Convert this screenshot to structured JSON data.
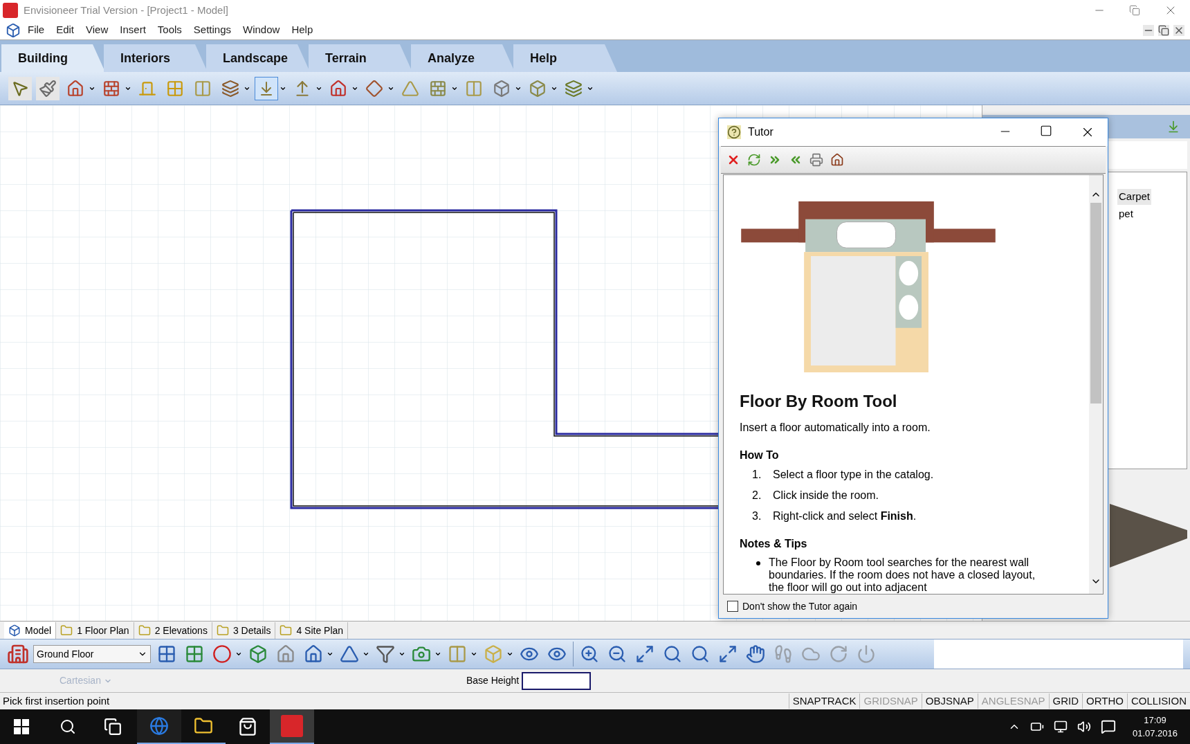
{
  "window": {
    "title": "Envisioneer Trial Version - [Project1 - Model]"
  },
  "menu": [
    "File",
    "Edit",
    "View",
    "Insert",
    "Tools",
    "Settings",
    "Window",
    "Help"
  ],
  "ribbon_tabs": [
    {
      "label": "Building",
      "selected": true
    },
    {
      "label": "Interiors",
      "selected": false
    },
    {
      "label": "Landscape",
      "selected": false
    },
    {
      "label": "Terrain",
      "selected": false
    },
    {
      "label": "Analyze",
      "selected": false
    },
    {
      "label": "Help",
      "selected": false
    }
  ],
  "catalog_panel": {
    "items": [
      {
        "label": "Carpet",
        "selected": true
      },
      {
        "label": "pet",
        "selected": false
      }
    ]
  },
  "tutor": {
    "title": "Tutor",
    "heading": "Floor By Room Tool",
    "intro": "Insert a floor automatically into a room.",
    "how_to_heading": "How To",
    "steps": [
      {
        "number": "1.",
        "text": "Select a floor type in the catalog."
      },
      {
        "number": "2.",
        "text": "Click inside the room."
      },
      {
        "number": "3.",
        "text": "Right-click and select **Finish**."
      }
    ],
    "notes_heading": "Notes & Tips",
    "notes": [
      "The Floor by Room tool searches for the nearest wall boundaries. If the room does not have a closed layout, the floor will go out into adjacent"
    ],
    "dont_show_again": {
      "label": "Don't show the Tutor again",
      "checked": false
    }
  },
  "sheet_tabs": [
    {
      "label": "Model",
      "selected": true
    },
    {
      "label": "1 Floor Plan",
      "selected": false
    },
    {
      "label": "2 Elevations",
      "selected": false
    },
    {
      "label": "3 Details",
      "selected": false
    },
    {
      "label": "4 Site Plan",
      "selected": false
    }
  ],
  "level_select": {
    "value": "Ground Floor"
  },
  "coordinates": {
    "mode": "Cartesian",
    "disabled": true,
    "base_height_label": "Base Height"
  },
  "status_bar": {
    "message": "Pick first insertion point",
    "toggles": [
      {
        "label": "SNAPTRACK",
        "on": true
      },
      {
        "label": "GRIDSNAP",
        "on": false
      },
      {
        "label": "OBJSNAP",
        "on": true
      },
      {
        "label": "ANGLESNAP",
        "on": false
      },
      {
        "label": "GRID",
        "on": true
      },
      {
        "label": "ORTHO",
        "on": true
      },
      {
        "label": "COLLISION",
        "on": true
      }
    ]
  },
  "taskbar": {
    "time": "17:09",
    "date": "01.07.2016"
  }
}
